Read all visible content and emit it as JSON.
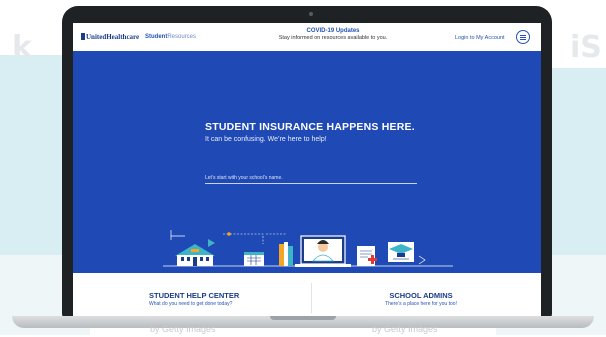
{
  "header": {
    "logo_text": "UnitedHealthcare",
    "brand_bold": "Student",
    "brand_light": "Resources",
    "covid_title": "COVID-19 Updates",
    "covid_subtitle": "Stay informed on resources available to you.",
    "login_label": "Login to My Account",
    "menu_icon": "hamburger-icon"
  },
  "hero": {
    "headline": "STUDENT INSURANCE HAPPENS HERE.",
    "subheadline": "It can be confusing. We’re here to help!",
    "school_placeholder": "Let’s start with your school’s name."
  },
  "cards": {
    "student_title": "STUDENT HELP CENTER",
    "student_sub": "What do you need to get done today?",
    "admin_title": "SCHOOL ADMINS",
    "admin_sub": "There’s a place here for you too!"
  },
  "watermark": {
    "text_left": "by Getty Images",
    "text_right": "by Getty Images",
    "letters_left": "k",
    "letters_right": "iS"
  },
  "colors": {
    "brand_blue": "#1f49b4",
    "dark_blue": "#1b3c8a",
    "accent_orange": "#f5a623",
    "accent_teal": "#3fb4c8",
    "accent_red": "#e03a3a"
  }
}
